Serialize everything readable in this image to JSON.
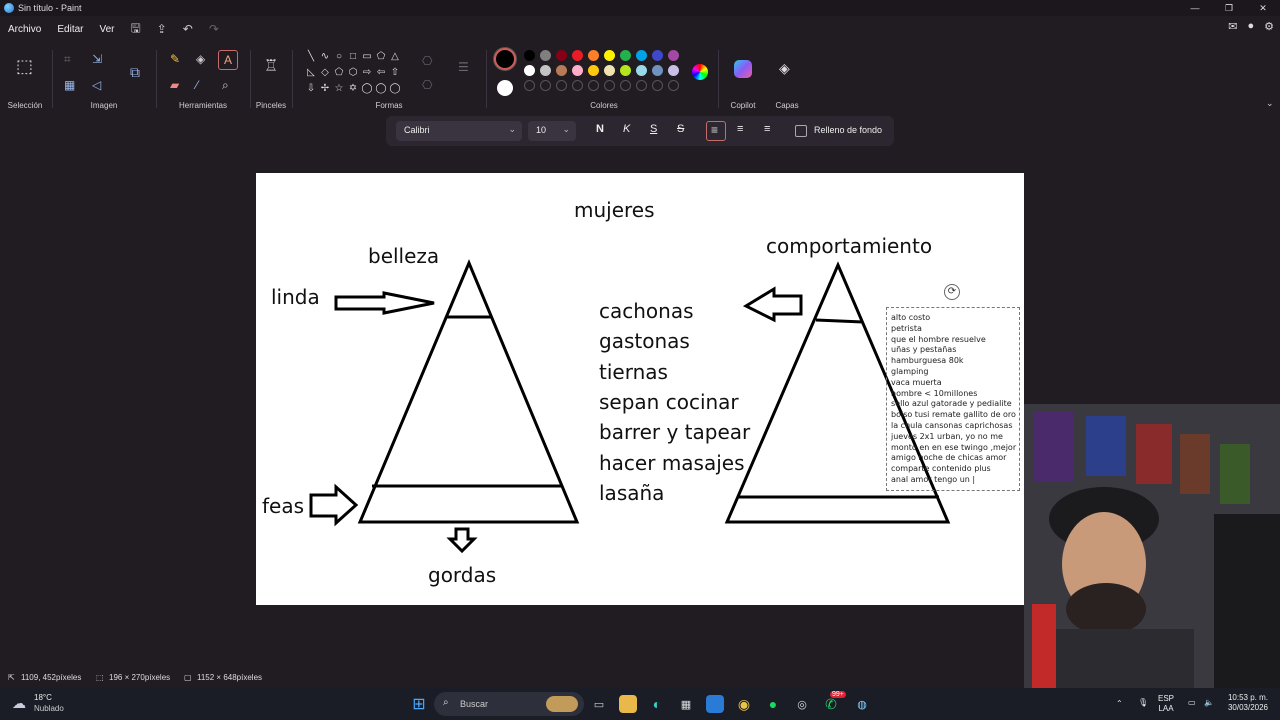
{
  "window": {
    "title": "Sin título - Paint",
    "controls": [
      "—",
      "❐",
      "✕"
    ]
  },
  "menu": {
    "items": [
      "Archivo",
      "Editar",
      "Ver"
    ]
  },
  "ribbon": {
    "groups": {
      "seleccion": "Selección",
      "imagen": "Imagen",
      "herramientas": "Herramientas",
      "pinceles": "Pinceles",
      "formas": "Formas",
      "colores": "Colores",
      "copilot": "Copilot",
      "capas": "Capas"
    },
    "shapes": [
      "╲",
      "∿",
      "○",
      "□",
      "▭",
      "⬠",
      "△",
      "◺",
      "◇",
      "⬠",
      "⬡",
      "⇨",
      "⇦",
      "⇧",
      "⇩",
      "✢",
      "☆",
      "✡",
      "◯",
      "◯",
      "◯"
    ],
    "palette": [
      "#000000",
      "#7f7f7f",
      "#880015",
      "#ed1c24",
      "#ff7f27",
      "#fff200",
      "#22b14c",
      "#00a2e8",
      "#3f48cc",
      "#a349a4",
      "#ffffff",
      "#c3c3c3",
      "#b97a57",
      "#ffaec9",
      "#ffc90e",
      "#efe4b0",
      "#b5e61d",
      "#99d9ea",
      "#7092be",
      "#c8bfe7"
    ]
  },
  "text_toolbar": {
    "font": "Calibri",
    "size": "10",
    "bold": "N",
    "italic": "K",
    "underline": "S",
    "strike": "S",
    "fill_label": "Relleno de fondo"
  },
  "canvas": {
    "title": "mujeres",
    "left_top": "belleza",
    "left_arrow_label": "linda",
    "left_bottom_label": "feas",
    "left_below": "gordas",
    "right_top": "comportamiento",
    "list": [
      "cachonas",
      "gastonas",
      "tiernas",
      "sepan cocinar",
      "barrer y tapear",
      "hacer masajes",
      "lasaña"
    ],
    "textbox_lines": [
      "alto costo",
      "petrista",
      "que el hombre resuelve",
      "uñas y pestañas",
      "hamburguesa 80k",
      "glamping",
      "vaca muerta",
      "hombre < 10millones",
      "sello azul gatorade y pedialite",
      "bolso tusi remate gallito de oro",
      "la chula cansonas caprichosas",
      "jueves 2x1 urban, yo no me",
      "monto en en ese twingo ,mejor",
      "amigo noche de chicas amor",
      "comparte contenido plus",
      "anal amor tengo un |"
    ]
  },
  "status": {
    "cursor": "1109, 452píxeles",
    "selection": "196 × 270píxeles",
    "canvas_size": "1152 × 648píxeles"
  },
  "taskbar": {
    "weather_temp": "18°C",
    "weather_desc": "Nublado",
    "search_placeholder": "Buscar",
    "lang1": "ESP",
    "lang2": "LAA",
    "time": "10:53 p. m.",
    "date": "30/03/2026",
    "badge": "99+"
  }
}
